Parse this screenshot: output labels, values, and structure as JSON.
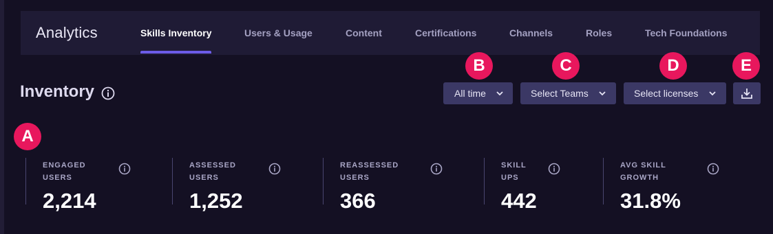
{
  "header": {
    "app_title": "Analytics",
    "tabs": [
      {
        "label": "Skills Inventory",
        "active": true
      },
      {
        "label": "Users & Usage"
      },
      {
        "label": "Content"
      },
      {
        "label": "Certifications"
      },
      {
        "label": "Channels"
      },
      {
        "label": "Roles"
      },
      {
        "label": "Tech Foundations"
      }
    ]
  },
  "page": {
    "title": "Inventory",
    "info_icon": "info-icon"
  },
  "filters": {
    "time": {
      "value": "All time",
      "icon": "chevron-down-icon"
    },
    "teams": {
      "value": "Select Teams",
      "icon": "chevron-down-icon"
    },
    "licenses": {
      "value": "Select licenses",
      "icon": "chevron-down-icon"
    },
    "download": {
      "icon": "download-icon"
    }
  },
  "markers": {
    "a": "A",
    "b": "B",
    "c": "C",
    "d": "D",
    "e": "E"
  },
  "stats": [
    {
      "label": "ENGAGED USERS",
      "value": "2,214"
    },
    {
      "label": "ASSESSED USERS",
      "value": "1,252"
    },
    {
      "label": "REASSESSED USERS",
      "value": "366"
    },
    {
      "label": "SKILL UPS",
      "value": "442"
    },
    {
      "label": "AVG SKILL GROWTH",
      "value": "31.8%"
    }
  ],
  "colors": {
    "background": "#141023",
    "topbar": "#1f1b35",
    "accent": "#6c5ce7",
    "control": "#3b3865",
    "marker": "#e8175d"
  }
}
